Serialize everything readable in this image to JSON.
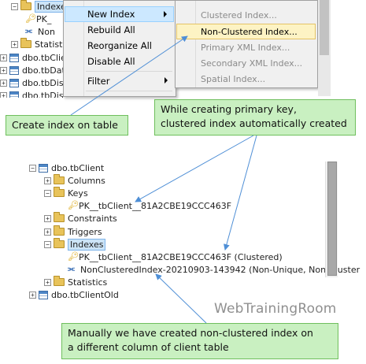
{
  "top_tree": {
    "rows": [
      {
        "label": "Indexes",
        "icon": "folder",
        "expander": "−"
      },
      {
        "label": "PK_",
        "icon": "key"
      },
      {
        "label": "Non",
        "icon": "index"
      },
      {
        "label": "Statisti",
        "icon": "folder",
        "expander": "+"
      },
      {
        "label": "dbo.tbClie",
        "icon": "table",
        "expander": "+"
      },
      {
        "label": "dbo.tbDate",
        "icon": "table",
        "expander": "+"
      },
      {
        "label": "dbo.tbDisa",
        "icon": "table",
        "expander": "+"
      },
      {
        "label": "dbo.tbDisa",
        "icon": "table",
        "expander": "+"
      }
    ]
  },
  "context_menu": {
    "items": [
      "New Index",
      "Rebuild All",
      "Reorganize All",
      "Disable All",
      "Filter"
    ]
  },
  "submenu": {
    "items": [
      "Clustered Index...",
      "Non-Clustered Index...",
      "Primary XML Index...",
      "Secondary XML Index...",
      "Spatial Index..."
    ]
  },
  "callouts": {
    "create_index": "Create index on table",
    "primary_key_line1": "While creating primary key,",
    "primary_key_line2": "clustered index automatically created",
    "manual_line1": "Manually we have created non-clustered  index on",
    "manual_line2": "a different column of client table"
  },
  "bottom_tree": {
    "table": "dbo.tbClient",
    "columns": "Columns",
    "keys": "Keys",
    "pk_key": "PK__tbClient__81A2CBE19CCC463F",
    "constraints": "Constraints",
    "triggers": "Triggers",
    "indexes": "Indexes",
    "pk_index": "PK__tbClient__81A2CBE19CCC463F (Clustered)",
    "nc_index": "NonClusteredIndex-20210903-143942 (Non-Unique, Non-Cluster",
    "statistics": "Statistics",
    "next_table": "dbo.tbClientOld"
  },
  "watermark": "WebTrainingRoom",
  "colors": {
    "callout_bg": "#c9f0c1",
    "callout_border": "#6fbf5d",
    "arrow": "#4f8fd6",
    "selection": "#cce4f7"
  }
}
